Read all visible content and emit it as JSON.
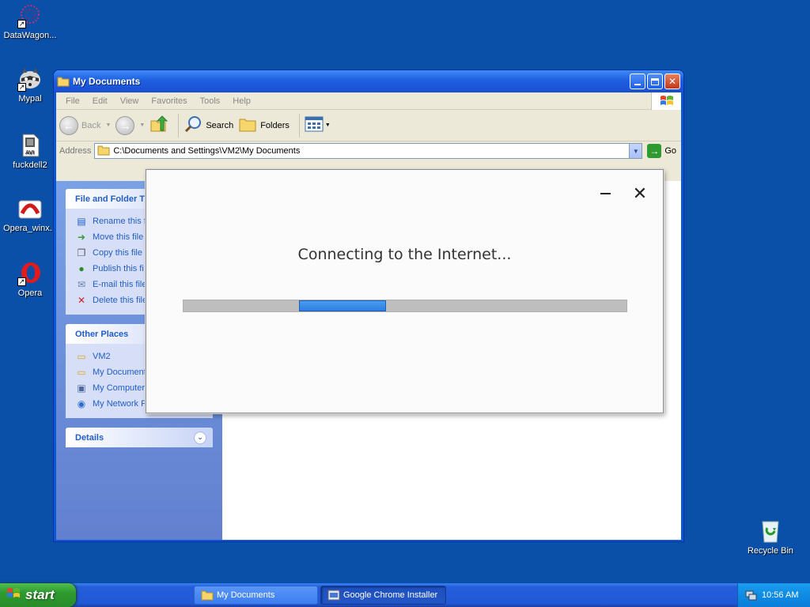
{
  "desktop": {
    "icons": [
      {
        "label": "DataWagon..."
      },
      {
        "label": "Mypal"
      },
      {
        "label": "fuckdell2"
      },
      {
        "label": "Opera_winx..."
      },
      {
        "label": "Opera"
      },
      {
        "label": "Recycle Bin"
      }
    ]
  },
  "explorer": {
    "title": "My Documents",
    "menu": [
      "File",
      "Edit",
      "View",
      "Favorites",
      "Tools",
      "Help"
    ],
    "toolbar": {
      "back": "Back",
      "search": "Search",
      "folders": "Folders"
    },
    "address": {
      "label": "Address",
      "value": "C:\\Documents and Settings\\VM2\\My Documents",
      "go": "Go"
    },
    "file_tasks": {
      "title": "File and Folder T",
      "items": [
        "Rename this f",
        "Move this file",
        "Copy this file",
        "Publish this fi",
        "E-mail this file",
        "Delete this file"
      ]
    },
    "other_places": {
      "title": "Other Places",
      "items": [
        "VM2",
        "My Document",
        "My Computer",
        "My Network P"
      ]
    },
    "details": {
      "title": "Details"
    }
  },
  "installer": {
    "message": "Connecting to the Internet...",
    "progress_fraction": 0.2
  },
  "taskbar": {
    "start": "start",
    "tasks": [
      "My Documents",
      "Google Chrome Installer"
    ],
    "clock": "10:56 AM"
  }
}
